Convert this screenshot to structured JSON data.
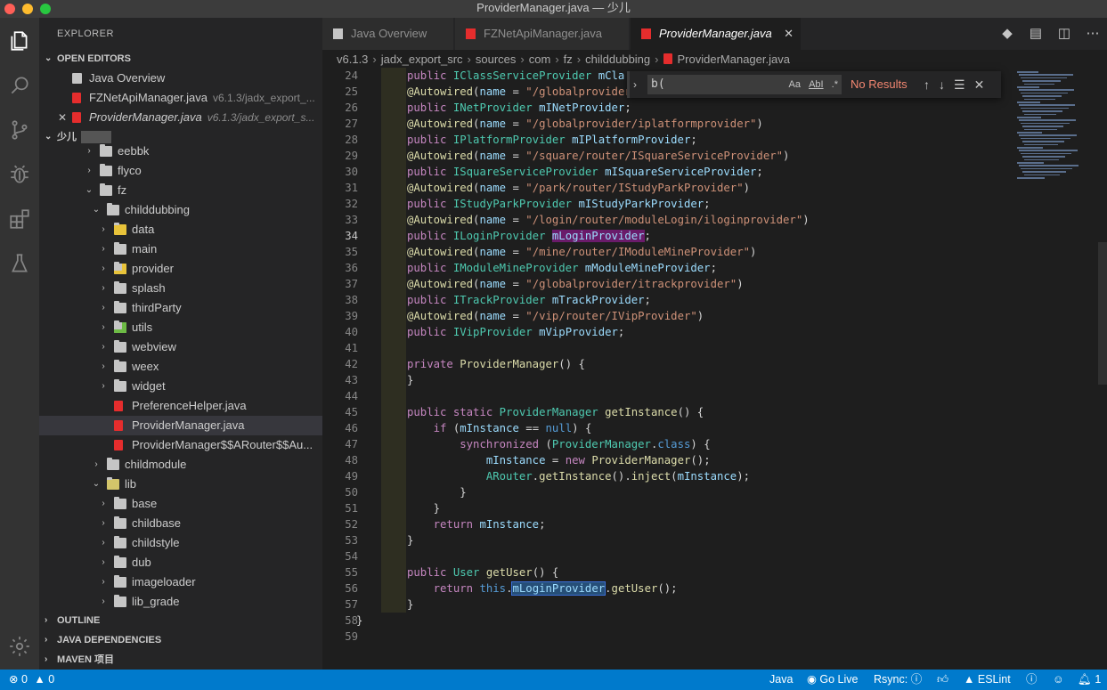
{
  "window": {
    "title": "ProviderManager.java — 少儿"
  },
  "sidebar": {
    "title": "EXPLORER",
    "open_editors_header": "OPEN EDITORS",
    "open_editors": [
      {
        "label": "Java Overview",
        "desc": ""
      },
      {
        "label": "FZNetApiManager.java",
        "desc": "v6.1.3/jadx_export_..."
      },
      {
        "label": "ProviderManager.java",
        "desc": "v6.1.3/jadx_export_s..."
      }
    ],
    "workspace_header": "少儿",
    "tree": [
      {
        "label": "eebbk",
        "indent": 1,
        "type": "folder",
        "chev": "›"
      },
      {
        "label": "flyco",
        "indent": 1,
        "type": "folder",
        "chev": "›"
      },
      {
        "label": "fz",
        "indent": 1,
        "type": "folder-open",
        "chev": "⌄"
      },
      {
        "label": "childdubbing",
        "indent": 2,
        "type": "folder-open",
        "chev": "⌄"
      },
      {
        "label": "data",
        "indent": 3,
        "type": "folder-data",
        "chev": "›"
      },
      {
        "label": "main",
        "indent": 3,
        "type": "folder",
        "chev": "›"
      },
      {
        "label": "provider",
        "indent": 3,
        "type": "folder-provider",
        "chev": "›"
      },
      {
        "label": "splash",
        "indent": 3,
        "type": "folder",
        "chev": "›"
      },
      {
        "label": "thirdParty",
        "indent": 3,
        "type": "folder",
        "chev": "›"
      },
      {
        "label": "utils",
        "indent": 3,
        "type": "folder-utils",
        "chev": "›"
      },
      {
        "label": "webview",
        "indent": 3,
        "type": "folder",
        "chev": "›"
      },
      {
        "label": "weex",
        "indent": 3,
        "type": "folder",
        "chev": "›"
      },
      {
        "label": "widget",
        "indent": 3,
        "type": "folder",
        "chev": "›"
      },
      {
        "label": "PreferenceHelper.java",
        "indent": 3,
        "type": "java",
        "chev": ""
      },
      {
        "label": "ProviderManager.java",
        "indent": 3,
        "type": "java",
        "chev": "",
        "selected": true
      },
      {
        "label": "ProviderManager$$ARouter$$Au...",
        "indent": 3,
        "type": "java",
        "chev": ""
      },
      {
        "label": "childmodule",
        "indent": 2,
        "type": "folder",
        "chev": "›"
      },
      {
        "label": "lib",
        "indent": 2,
        "type": "folder-lib",
        "chev": "⌄"
      },
      {
        "label": "base",
        "indent": 3,
        "type": "folder",
        "chev": "›"
      },
      {
        "label": "childbase",
        "indent": 3,
        "type": "folder",
        "chev": "›"
      },
      {
        "label": "childstyle",
        "indent": 3,
        "type": "folder",
        "chev": "›"
      },
      {
        "label": "dub",
        "indent": 3,
        "type": "folder",
        "chev": "›"
      },
      {
        "label": "imageloader",
        "indent": 3,
        "type": "folder",
        "chev": "›"
      },
      {
        "label": "lib_grade",
        "indent": 3,
        "type": "folder",
        "chev": "›"
      }
    ],
    "bottom_sections": [
      "OUTLINE",
      "JAVA DEPENDENCIES",
      "MAVEN 项目"
    ]
  },
  "tabs": [
    {
      "label": "Java Overview",
      "active": false
    },
    {
      "label": "FZNetApiManager.java",
      "active": false
    },
    {
      "label": "ProviderManager.java",
      "active": true
    }
  ],
  "breadcrumb": [
    "v6.1.3",
    "jadx_export_src",
    "sources",
    "com",
    "fz",
    "childdubbing",
    "ProviderManager.java"
  ],
  "find": {
    "value": "b(",
    "result": "No Results",
    "opt_case": "Aa",
    "opt_word": "AbI",
    "opt_regex": ".*"
  },
  "code": {
    "current_line": 34,
    "lines": [
      {
        "n": 24,
        "html": "<span class=\"k\">public</span> <span class=\"t\">IClassServiceProvider</span> <span class=\"v\">mCla</span>"
      },
      {
        "n": 25,
        "html": "<span class=\"a\">@Autowired</span>(<span class=\"v\">name</span> = <span class=\"s\">\"/globalprovider</span>"
      },
      {
        "n": 26,
        "html": "<span class=\"k\">public</span> <span class=\"t\">INetProvider</span> <span class=\"v\">mINetProvider</span>;"
      },
      {
        "n": 27,
        "html": "<span class=\"a\">@Autowired</span>(<span class=\"v\">name</span> = <span class=\"s\">\"/globalprovider/iplatformprovider\"</span>)"
      },
      {
        "n": 28,
        "html": "<span class=\"k\">public</span> <span class=\"t\">IPlatformProvider</span> <span class=\"v\">mIPlatformProvider</span>;"
      },
      {
        "n": 29,
        "html": "<span class=\"a\">@Autowired</span>(<span class=\"v\">name</span> = <span class=\"s\">\"/square/router/ISquareServiceProvider\"</span>)"
      },
      {
        "n": 30,
        "html": "<span class=\"k\">public</span> <span class=\"t\">ISquareServiceProvider</span> <span class=\"v\">mISquareServiceProvider</span>;"
      },
      {
        "n": 31,
        "html": "<span class=\"a\">@Autowired</span>(<span class=\"v\">name</span> = <span class=\"s\">\"/park/router/IStudyParkProvider\"</span>)"
      },
      {
        "n": 32,
        "html": "<span class=\"k\">public</span> <span class=\"t\">IStudyParkProvider</span> <span class=\"v\">mIStudyParkProvider</span>;"
      },
      {
        "n": 33,
        "html": "<span class=\"a\">@Autowired</span>(<span class=\"v\">name</span> = <span class=\"s\">\"/login/router/moduleLogin/iloginprovider\"</span>)"
      },
      {
        "n": 34,
        "html": "<span class=\"k\">public</span> <span class=\"t\">ILoginProvider</span> <span class=\"v hl1\">mLoginProvider</span>;"
      },
      {
        "n": 35,
        "html": "<span class=\"a\">@Autowired</span>(<span class=\"v\">name</span> = <span class=\"s\">\"/mine/router/IModuleMineProvider\"</span>)"
      },
      {
        "n": 36,
        "html": "<span class=\"k\">public</span> <span class=\"t\">IModuleMineProvider</span> <span class=\"v\">mModuleMineProvider</span>;"
      },
      {
        "n": 37,
        "html": "<span class=\"a\">@Autowired</span>(<span class=\"v\">name</span> = <span class=\"s\">\"/globalprovider/itrackprovider\"</span>)"
      },
      {
        "n": 38,
        "html": "<span class=\"k\">public</span> <span class=\"t\">ITrackProvider</span> <span class=\"v\">mTrackProvider</span>;"
      },
      {
        "n": 39,
        "html": "<span class=\"a\">@Autowired</span>(<span class=\"v\">name</span> = <span class=\"s\">\"/vip/router/IVipProvider\"</span>)"
      },
      {
        "n": 40,
        "html": "<span class=\"k\">public</span> <span class=\"t\">IVipProvider</span> <span class=\"v\">mVipProvider</span>;"
      },
      {
        "n": 41,
        "html": ""
      },
      {
        "n": 42,
        "html": "<span class=\"k\">private</span> <span class=\"f\">ProviderManager</span>() {"
      },
      {
        "n": 43,
        "html": "}"
      },
      {
        "n": 44,
        "html": ""
      },
      {
        "n": 45,
        "html": "<span class=\"k\">public</span> <span class=\"k\">static</span> <span class=\"t\">ProviderManager</span> <span class=\"f\">getInstance</span>() {"
      },
      {
        "n": 46,
        "html": "    <span class=\"k\">if</span> (<span class=\"v\">mInstance</span> == <span class=\"kb\">null</span>) {"
      },
      {
        "n": 47,
        "html": "        <span class=\"k\">synchronized</span> (<span class=\"t\">ProviderManager</span>.<span class=\"kb\">class</span>) {"
      },
      {
        "n": 48,
        "html": "            <span class=\"v\">mInstance</span> = <span class=\"k\">new</span> <span class=\"f\">ProviderManager</span>();"
      },
      {
        "n": 49,
        "html": "            <span class=\"t\">ARouter</span>.<span class=\"f\">getInstance</span>().<span class=\"f\">inject</span>(<span class=\"v\">mInstance</span>);"
      },
      {
        "n": 50,
        "html": "        }"
      },
      {
        "n": 51,
        "html": "    }"
      },
      {
        "n": 52,
        "html": "    <span class=\"k\">return</span> <span class=\"v\">mInstance</span>;"
      },
      {
        "n": 53,
        "html": "}"
      },
      {
        "n": 54,
        "html": ""
      },
      {
        "n": 55,
        "html": "<span class=\"k\">public</span> <span class=\"t\">User</span> <span class=\"f\">getUser</span>() {"
      },
      {
        "n": 56,
        "html": "    <span class=\"k\">return</span> <span class=\"kb\">this</span>.<span class=\"v hl2\">mLoginProvider</span>.<span class=\"f\">getUser</span>();"
      },
      {
        "n": 57,
        "html": "}"
      },
      {
        "n": 58,
        "html": "}"
      },
      {
        "n": 59,
        "html": ""
      }
    ]
  },
  "statusbar": {
    "errors": "0",
    "warnings": "0",
    "language": "Java",
    "golive": "Go Live",
    "rsync": "Rsync:",
    "eslint": "ESLint",
    "notifications": "1"
  },
  "colors": {
    "accent": "#007acc",
    "java_icon": "#e52d2d"
  },
  "icons": {
    "activity": [
      "files-icon",
      "search-icon",
      "source-control-icon",
      "debug-icon",
      "extensions-icon",
      "test-flask-icon",
      "settings-gear-icon"
    ]
  }
}
